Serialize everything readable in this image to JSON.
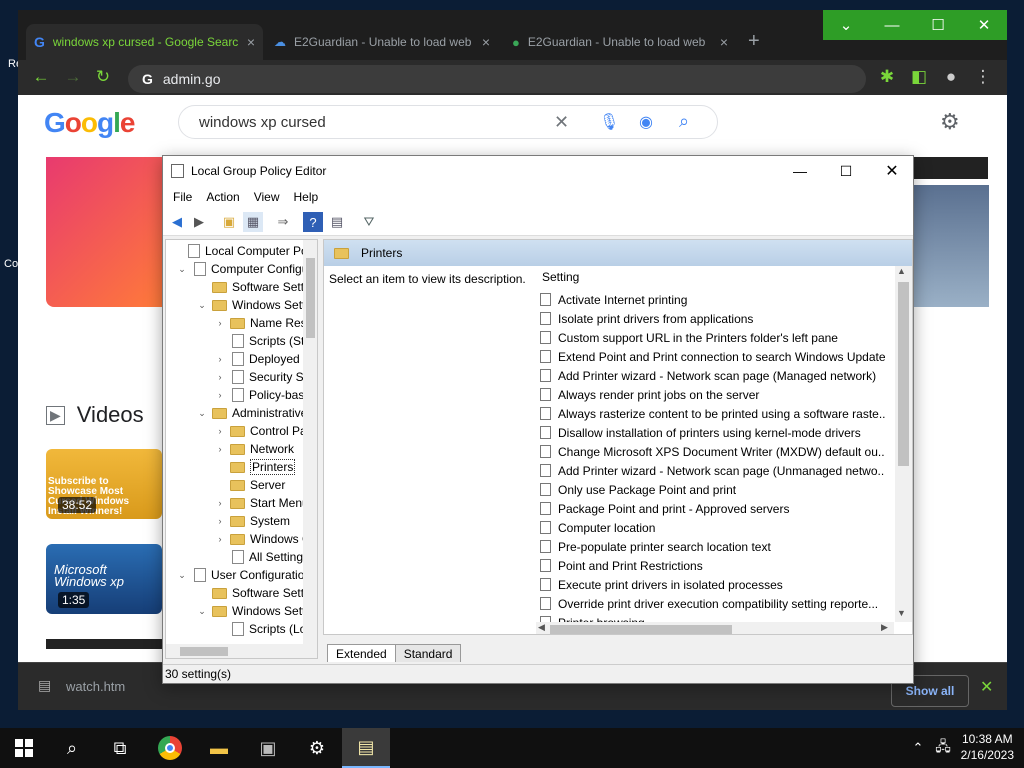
{
  "desktop": {
    "fragment_r": "Re",
    "fragment_co": "Co"
  },
  "browser": {
    "tabs": [
      {
        "title": "windows xp cursed - Google Search",
        "close": "×"
      },
      {
        "title": "E2Guardian - Unable to load web",
        "close": "×"
      },
      {
        "title": "E2Guardian - Unable to load web",
        "close": "×"
      }
    ],
    "new_tab": "+",
    "window_buttons": [
      "⌄",
      "—",
      "☐",
      "✕"
    ],
    "address": "admin.go",
    "google": {
      "logo": "Google",
      "query": "windows xp cursed",
      "videos_heading": "Videos",
      "video_durations": [
        "38:52",
        "1:35"
      ],
      "video_captions": [
        "Subscribe to Showcase Most Cursed Windows Install Winners!",
        "Microsoft Windows xp"
      ]
    },
    "download": {
      "file": "watch.htm",
      "show_all": "Show all"
    }
  },
  "gpedit": {
    "title": "Local Group Policy Editor",
    "menu": [
      "File",
      "Action",
      "View",
      "Help"
    ],
    "tree": [
      {
        "label": "Local Computer Policy",
        "level": 0,
        "arrow": "",
        "icon": "computer"
      },
      {
        "label": "Computer Configuration",
        "level": 1,
        "arrow": "v",
        "icon": "computer"
      },
      {
        "label": "Software Settings",
        "level": 2,
        "arrow": "",
        "icon": "folder"
      },
      {
        "label": "Windows Settings",
        "level": 2,
        "arrow": "v",
        "icon": "folder"
      },
      {
        "label": "Name Resolution Policy",
        "level": 3,
        "arrow": ">",
        "icon": "folder"
      },
      {
        "label": "Scripts (Startup/Shutdown)",
        "level": 3,
        "arrow": "",
        "icon": "doc"
      },
      {
        "label": "Deployed Printers",
        "level": 3,
        "arrow": ">",
        "icon": "printer"
      },
      {
        "label": "Security Settings",
        "level": 3,
        "arrow": ">",
        "icon": "doc"
      },
      {
        "label": "Policy-based QoS",
        "level": 3,
        "arrow": ">",
        "icon": "chart"
      },
      {
        "label": "Administrative Templates",
        "level": 2,
        "arrow": "v",
        "icon": "folder"
      },
      {
        "label": "Control Panel",
        "level": 3,
        "arrow": ">",
        "icon": "folder"
      },
      {
        "label": "Network",
        "level": 3,
        "arrow": ">",
        "icon": "folder"
      },
      {
        "label": "Printers",
        "level": 3,
        "arrow": "",
        "icon": "folder",
        "selected": true
      },
      {
        "label": "Server",
        "level": 3,
        "arrow": "",
        "icon": "folder"
      },
      {
        "label": "Start Menu and Taskbar",
        "level": 3,
        "arrow": ">",
        "icon": "folder"
      },
      {
        "label": "System",
        "level": 3,
        "arrow": ">",
        "icon": "folder"
      },
      {
        "label": "Windows Components",
        "level": 3,
        "arrow": ">",
        "icon": "folder"
      },
      {
        "label": "All Settings",
        "level": 3,
        "arrow": "",
        "icon": "doc"
      },
      {
        "label": "User Configuration",
        "level": 1,
        "arrow": "v",
        "icon": "computer"
      },
      {
        "label": "Software Settings",
        "level": 2,
        "arrow": "",
        "icon": "folder"
      },
      {
        "label": "Windows Settings",
        "level": 2,
        "arrow": "v",
        "icon": "folder"
      },
      {
        "label": "Scripts (Logon/Logoff)",
        "level": 3,
        "arrow": "",
        "icon": "doc"
      }
    ],
    "breadcrumb": "Printers",
    "description": "Select an item to view its description.",
    "settings_header": "Setting",
    "settings": [
      "Activate Internet printing",
      "Isolate print drivers from applications",
      "Custom support URL in the Printers folder's left pane",
      "Extend Point and Print connection to search Windows Update",
      "Add Printer wizard - Network scan page (Managed network)",
      "Always render print jobs on the server",
      "Always rasterize content to be printed using a software raste...",
      "Disallow installation of printers using kernel-mode drivers",
      "Change Microsoft XPS Document Writer (MXDW) default ou...",
      "Add Printer wizard - Network scan page (Unmanaged netwo...",
      "Only use Package Point and print",
      "Package Point and print - Approved servers",
      "Computer location",
      "Pre-populate printer search location text",
      "Point and Print Restrictions",
      "Execute print drivers in isolated processes",
      "Override print driver execution compatibility setting reporte...",
      "Printer browsing"
    ],
    "bottom_tabs": [
      "Extended",
      "Standard"
    ],
    "status": "30 setting(s)"
  },
  "taskbar": {
    "time": "10:38 AM",
    "date": "2/16/2023"
  }
}
